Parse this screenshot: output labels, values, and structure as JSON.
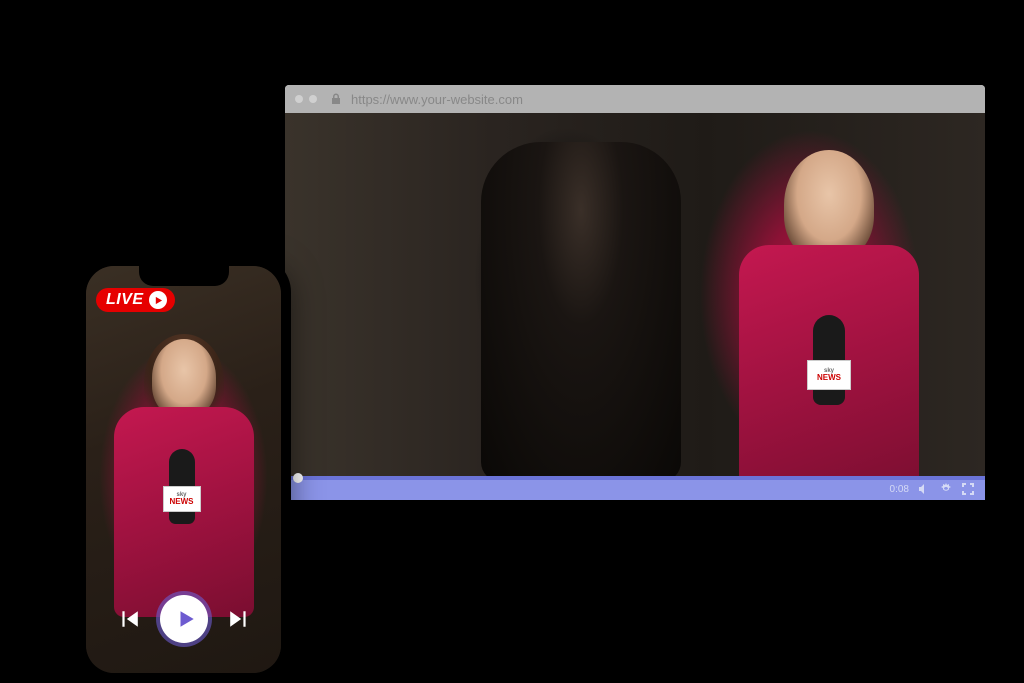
{
  "browser": {
    "url": "https://www.your-website.com",
    "player": {
      "time": "0:08"
    }
  },
  "phone": {
    "live_label": "LIVE"
  },
  "mic": {
    "brand_top": "sky",
    "brand_bottom": "NEWS"
  },
  "colors": {
    "live_red": "#e60000",
    "player_purple": "#8b94e8",
    "accent_purple": "#6d5bd0",
    "blazer": "#b01842"
  }
}
